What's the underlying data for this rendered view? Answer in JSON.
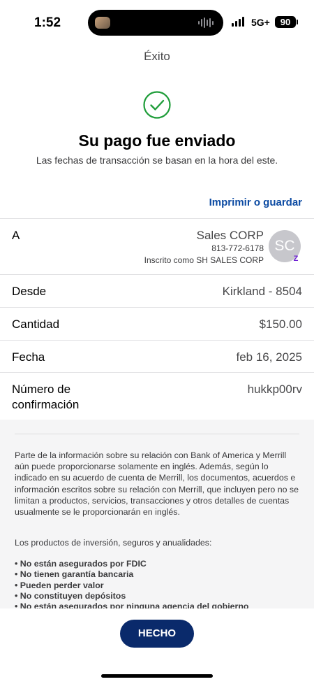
{
  "status_bar": {
    "time": "1:52",
    "network": "5G+",
    "battery": "90"
  },
  "header": {
    "title": "Éxito",
    "headline": "Su pago fue enviado",
    "subline": "Las fechas de transacción se basan en la hora del este.",
    "print_link": "Imprimir o guardar"
  },
  "details": {
    "payee": {
      "label": "A",
      "name": "Sales CORP",
      "phone": "813-772-6178",
      "enrolled_as": "Inscrito como SH SALES CORP",
      "avatar_initials": "SC",
      "badge_icon": "zelle-icon"
    },
    "from": {
      "label": "Desde",
      "value": "Kirkland - 8504"
    },
    "amount": {
      "label": "Cantidad",
      "value": "$150.00"
    },
    "date": {
      "label": "Fecha",
      "value": "feb 16, 2025"
    },
    "confirmation": {
      "label_line1": "Número de",
      "label_line2": "confirmación",
      "value": "hukkp00rv"
    }
  },
  "disclosure": {
    "paragraph_1": "Parte de la información sobre su relación con Bank of America y Merrill aún puede proporcionarse solamente en inglés. Además, según lo indicado en su acuerdo de cuenta de Merrill, los documentos, acuerdos e información escritos sobre su relación con Merrill, que incluyen pero no se limitan a productos, servicios, transacciones y otros detalles de cuentas usualmente se le proporcionarán en inglés.",
    "paragraph_2": "Los productos de inversión, seguros y anualidades:",
    "bullets": [
      "No están asegurados por FDIC",
      "No tienen garantía bancaria",
      "Pueden perder valor",
      "No constituyen depósitos",
      "No están asegurados por ninguna agencia del gobierno"
    ]
  },
  "footer": {
    "done_label": "HECHO"
  },
  "colors": {
    "accent_link": "#0b4aa2",
    "success_green": "#1f9d3a",
    "button_navy": "#0a2a6b"
  }
}
